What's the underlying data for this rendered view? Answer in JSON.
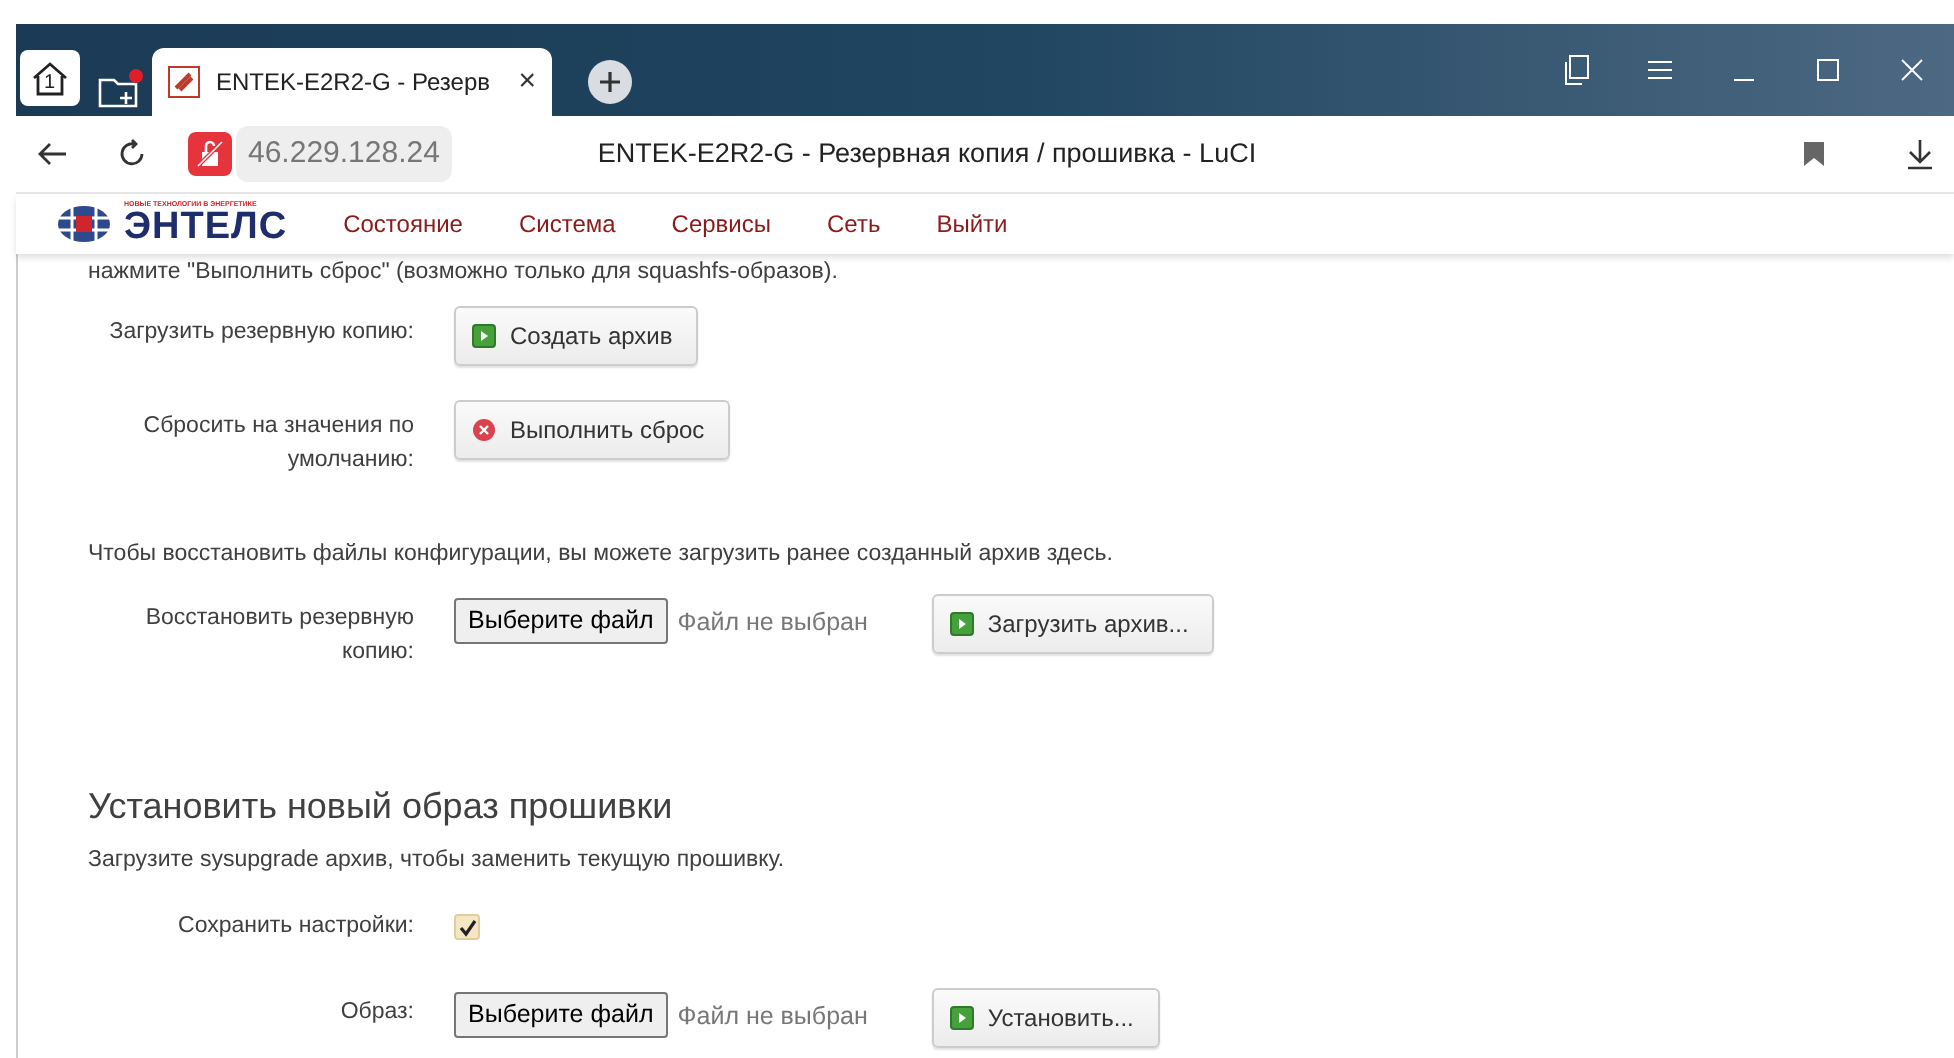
{
  "browser": {
    "tab_counter": "1",
    "tab": {
      "title": "ENTEK-E2R2-G - Резерв",
      "close": "×"
    },
    "address": "46.229.128.24",
    "page_title": "ENTEK-E2R2-G - Резервная копия / прошивка - LuCI"
  },
  "site": {
    "logo_tagline": "НОВЫЕ ТЕХНОЛОГИИ В ЭНЕРГЕТИКЕ",
    "logo_text": "ЭНТЕЛС",
    "menu": [
      "Состояние",
      "Система",
      "Сервисы",
      "Сеть",
      "Выйти"
    ]
  },
  "backup": {
    "note": "нажмите \"Выполнить сброс\" (возможно только для squashfs-образов).",
    "rows": [
      {
        "kind": "apply",
        "label": "Загрузить резервную копию:",
        "button": "Создать архив"
      },
      {
        "kind": "reset",
        "label": "Сбросить на значения по умолчанию:",
        "button": "Выполнить сброс"
      }
    ],
    "restore_note": "Чтобы восстановить файлы конфигурации, вы можете загрузить ранее созданный архив здесь.",
    "restore": {
      "label": "Восстановить резервную копию:",
      "file_button": "Выберите файл",
      "file_status": "Файл не выбран",
      "button": "Загрузить архив..."
    }
  },
  "flash": {
    "title": "Установить новый образ прошивки",
    "description": "Загрузите sysupgrade архив, чтобы заменить текущую прошивку.",
    "keep": {
      "label": "Сохранить настройки:",
      "checked": true
    },
    "image": {
      "label": "Образ:",
      "file_button": "Выберите файл",
      "file_status": "Файл не выбран",
      "button": "Установить..."
    }
  }
}
